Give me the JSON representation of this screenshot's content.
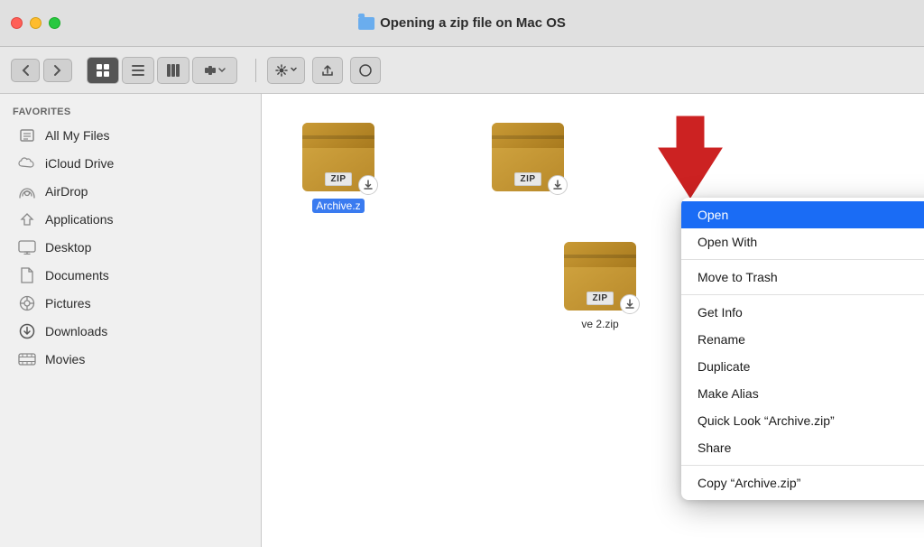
{
  "titleBar": {
    "title": "Opening a zip file on Mac OS"
  },
  "toolbar": {
    "backLabel": "‹",
    "forwardLabel": "›",
    "views": [
      "grid",
      "list",
      "columns",
      "cover-flow",
      "arrange"
    ],
    "actionLabel": "⚙",
    "shareLabel": "⬆",
    "tagsLabel": "◯"
  },
  "sidebar": {
    "sectionTitle": "Favorites",
    "items": [
      {
        "id": "all-my-files",
        "label": "All My Files",
        "icon": "file"
      },
      {
        "id": "icloud-drive",
        "label": "iCloud Drive",
        "icon": "cloud"
      },
      {
        "id": "airdrop",
        "label": "AirDrop",
        "icon": "airdrop"
      },
      {
        "id": "applications",
        "label": "Applications",
        "icon": "apps"
      },
      {
        "id": "desktop",
        "label": "Desktop",
        "icon": "desktop"
      },
      {
        "id": "documents",
        "label": "Documents",
        "icon": "doc"
      },
      {
        "id": "pictures",
        "label": "Pictures",
        "icon": "pictures"
      },
      {
        "id": "downloads",
        "label": "Downloads",
        "icon": "downloads"
      },
      {
        "id": "movies",
        "label": "Movies",
        "icon": "movies"
      }
    ]
  },
  "content": {
    "files": [
      {
        "id": "archive1",
        "label": "Archive.z",
        "selected": true,
        "hasZipBadge": true
      },
      {
        "id": "archive2",
        "label": "",
        "selected": false,
        "hasZipBadge": true
      },
      {
        "id": "archive3",
        "label": "ve 2.zip",
        "selected": false,
        "hasZipBadge": true
      }
    ]
  },
  "contextMenu": {
    "items": [
      {
        "id": "open",
        "label": "Open",
        "highlighted": true,
        "hasArrow": false,
        "separator": false
      },
      {
        "id": "open-with",
        "label": "Open With",
        "highlighted": false,
        "hasArrow": true,
        "separator": false
      },
      {
        "id": "move-to-trash",
        "label": "Move to Trash",
        "highlighted": false,
        "hasArrow": false,
        "separator": true
      },
      {
        "id": "get-info",
        "label": "Get Info",
        "highlighted": false,
        "hasArrow": false,
        "separator": false
      },
      {
        "id": "rename",
        "label": "Rename",
        "highlighted": false,
        "hasArrow": false,
        "separator": false
      },
      {
        "id": "duplicate",
        "label": "Duplicate",
        "highlighted": false,
        "hasArrow": false,
        "separator": false
      },
      {
        "id": "make-alias",
        "label": "Make Alias",
        "highlighted": false,
        "hasArrow": false,
        "separator": false
      },
      {
        "id": "quick-look",
        "label": "Quick Look “Archive.zip”",
        "highlighted": false,
        "hasArrow": false,
        "separator": false
      },
      {
        "id": "share",
        "label": "Share",
        "highlighted": false,
        "hasArrow": true,
        "separator": true
      },
      {
        "id": "copy",
        "label": "Copy “Archive.zip”",
        "highlighted": false,
        "hasArrow": false,
        "separator": false
      }
    ]
  }
}
